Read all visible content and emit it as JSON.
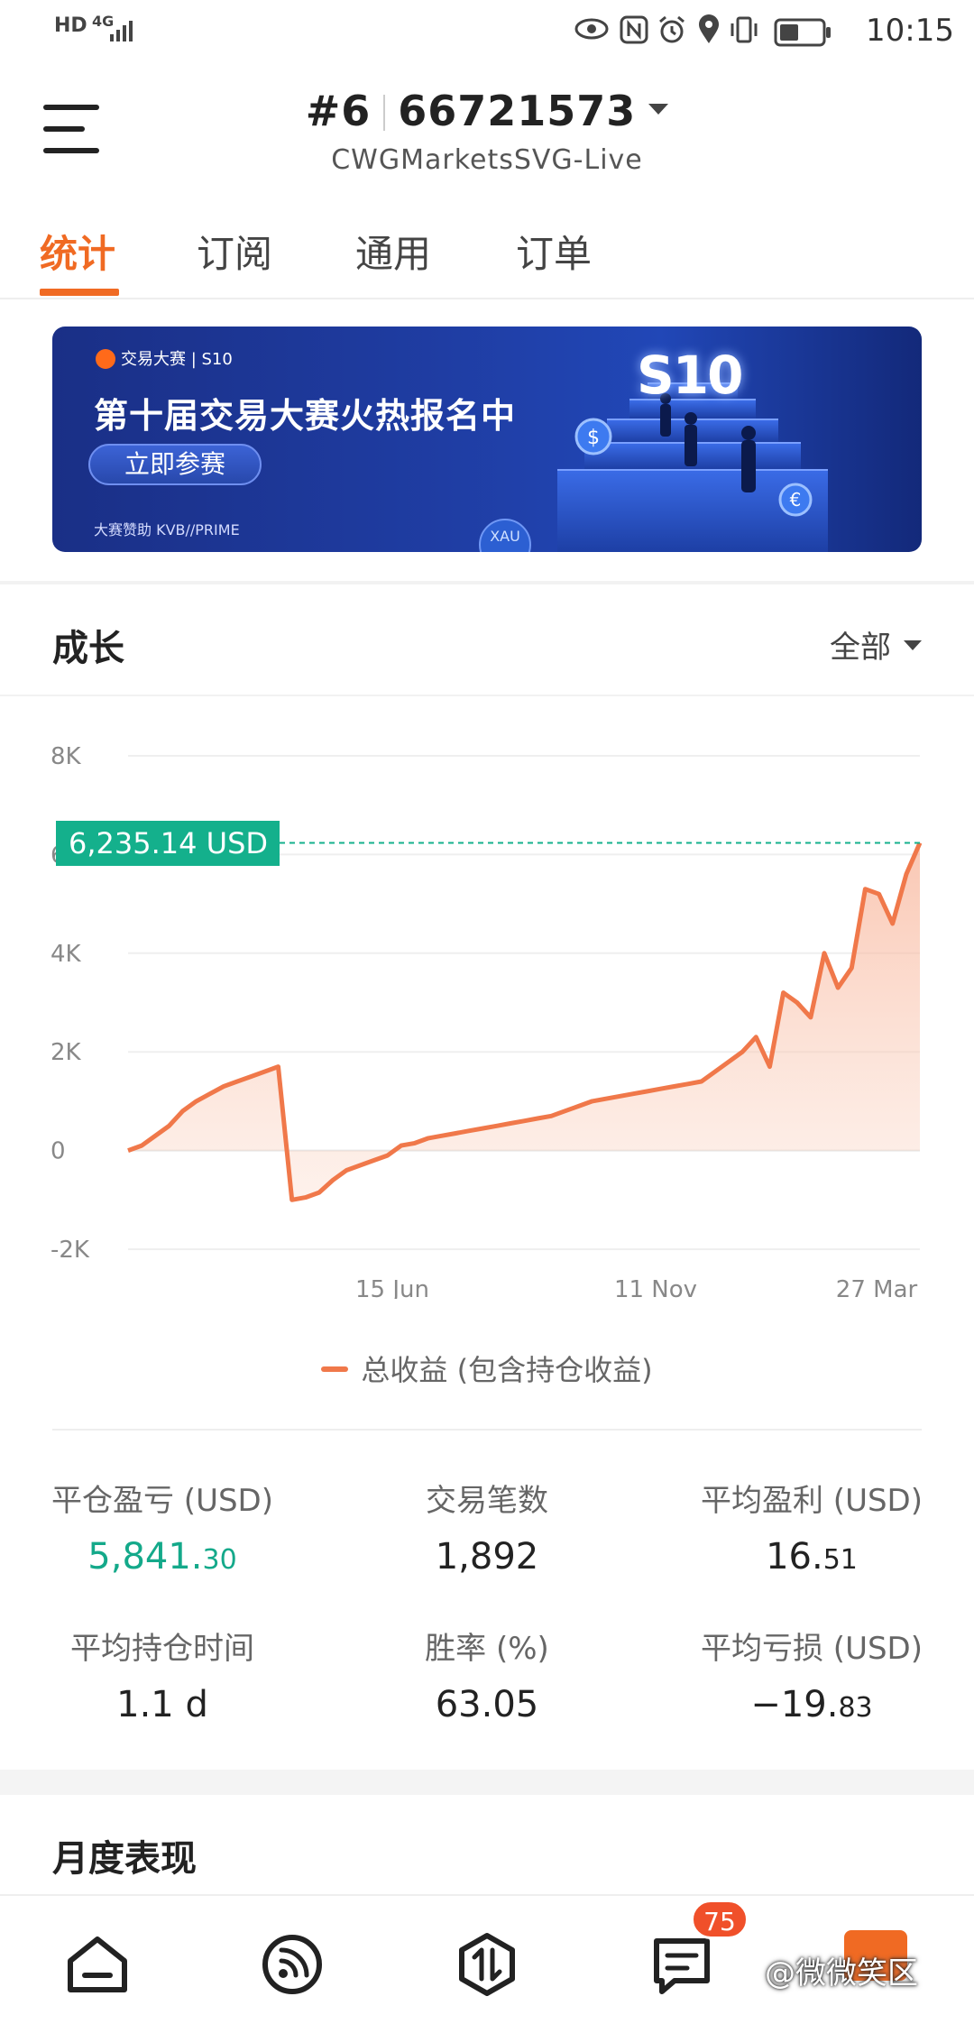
{
  "status_bar": {
    "left_badge": "HD",
    "network": "4G",
    "time": "10:15"
  },
  "header": {
    "account_rank": "#6",
    "account_number": "66721573",
    "server": "CWGMarketsSVG-Live"
  },
  "tabs": [
    {
      "label": "统计",
      "active": true
    },
    {
      "label": "订阅",
      "active": false
    },
    {
      "label": "通用",
      "active": false
    },
    {
      "label": "订单",
      "active": false
    }
  ],
  "banner": {
    "brand": "交易大赛 | S10",
    "headline": "第十届交易大赛火热报名中",
    "cta": "立即参赛",
    "sponsor": "大赛赞助  KVB//PRIME",
    "badge": "S10"
  },
  "growth": {
    "title": "成长",
    "filter": "全部",
    "current_value_label": "6,235.14 USD",
    "legend": "总收益 (包含持仓收益)"
  },
  "chart_data": {
    "type": "area",
    "series": [
      {
        "name": "总收益 (包含持仓收益)",
        "color": "#f0784a",
        "values": [
          0,
          100,
          300,
          500,
          800,
          1000,
          1150,
          1300,
          1400,
          1500,
          1600,
          1700,
          -1000,
          -950,
          -850,
          -600,
          -400,
          -300,
          -200,
          -100,
          100,
          150,
          250,
          300,
          350,
          400,
          450,
          500,
          550,
          600,
          650,
          700,
          800,
          900,
          1000,
          1050,
          1100,
          1150,
          1200,
          1250,
          1300,
          1350,
          1400,
          1600,
          1800,
          2000,
          2300,
          1700,
          3200,
          3000,
          2700,
          4000,
          3300,
          3700,
          5300,
          5200,
          4600,
          5600,
          6235
        ]
      }
    ],
    "x_tick_labels": [
      "15 Jun",
      "11 Nov",
      "27 Mar"
    ],
    "y_tick_labels": [
      "8K",
      "6K",
      "4K",
      "2K",
      "0",
      "-2K"
    ],
    "ylim": [
      -2000,
      8000
    ],
    "reference_value": 6235.14,
    "grid": true
  },
  "stats": [
    {
      "label": "平仓盈亏 (USD)",
      "value_main": "5,841.",
      "value_dec": "30",
      "green": true
    },
    {
      "label": "交易笔数",
      "value_main": "1,892",
      "value_dec": "",
      "green": false
    },
    {
      "label": "平均盈利 (USD)",
      "value_main": "16.",
      "value_dec": "51",
      "green": false
    },
    {
      "label": "平均持仓时间",
      "value_main": "1.1 d",
      "value_dec": "",
      "green": false
    },
    {
      "label": "胜率 (%)",
      "value_main": "63.05",
      "value_dec": "",
      "green": false
    },
    {
      "label": "平均亏损 (USD)",
      "value_main": "−19.",
      "value_dec": "83",
      "green": false
    }
  ],
  "monthly": {
    "title": "月度表现"
  },
  "bottom_nav": {
    "messages_badge": "75",
    "watermark": "@微微笑区"
  }
}
